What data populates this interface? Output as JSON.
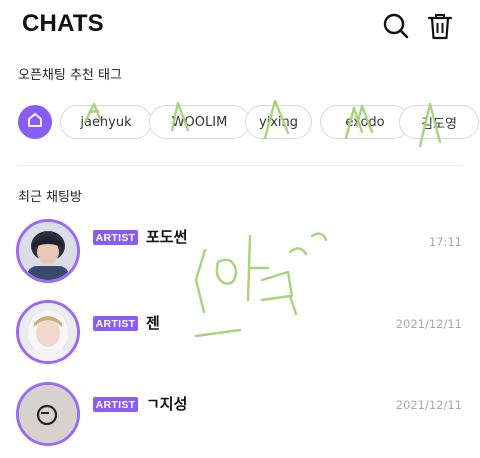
{
  "header": {
    "title": "CHATS",
    "search_icon": "search-icon",
    "trash_icon": "trash-icon"
  },
  "tags_section": {
    "label": "오픈채팅 추천 태그",
    "home_icon": "home-icon",
    "tags": [
      "jaehyuk",
      "WOOLIM",
      "yixing",
      "exodo",
      "김도영"
    ]
  },
  "recent_section": {
    "label": "최근 채팅방"
  },
  "chats": [
    {
      "badge": "ARTIST",
      "name": "포도썬",
      "time": "17:11"
    },
    {
      "badge": "ARTIST",
      "name": "젠",
      "time": "2021/12/11"
    },
    {
      "badge": "ARTIST",
      "name": "ㄱ지성",
      "time": "2021/12/11"
    }
  ],
  "colors": {
    "accent": "#8a5cf6",
    "ring": "#9b6cf2",
    "scribble": "#a6d47a"
  }
}
